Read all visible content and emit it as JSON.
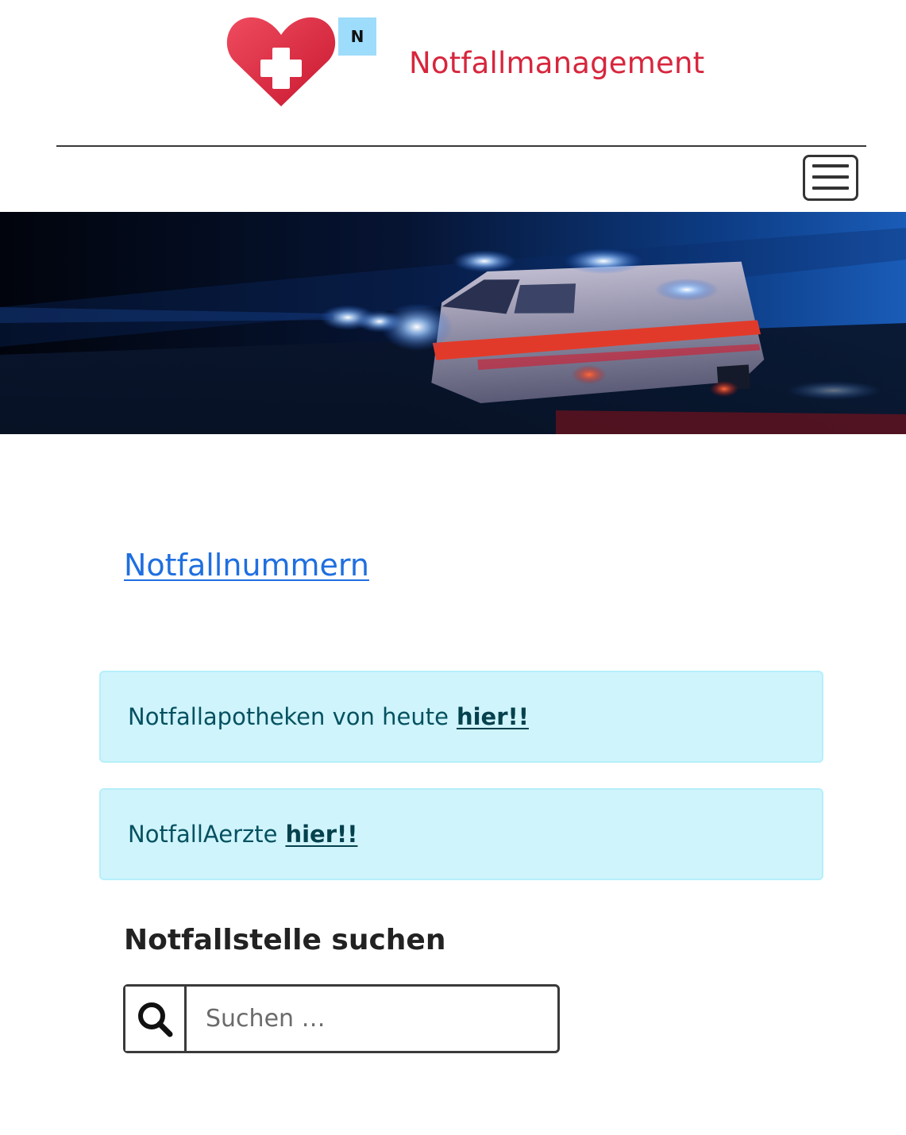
{
  "header": {
    "logo_badge": "N",
    "site_title": "Notfallmanagement",
    "menu_icon": "hamburger-menu-icon"
  },
  "hero": {
    "image": "ambulance-at-night-with-blue-lights"
  },
  "main": {
    "emergency_numbers_link": "Notfallnummern",
    "alerts": [
      {
        "text": "Notfallapotheken von heute",
        "link": "hier!!"
      },
      {
        "text": "NotfallAerzte",
        "link": "hier!!"
      }
    ],
    "search": {
      "heading": "Notfallstelle suchen",
      "placeholder": "Suchen …",
      "icon": "search-icon"
    }
  },
  "colors": {
    "brand_red": "#d7263d",
    "link_blue": "#1f6fe0",
    "alert_bg": "#cff4fc",
    "alert_border": "#b6effb",
    "alert_text": "#055160",
    "logo_badge_bg": "#9edcfb"
  }
}
